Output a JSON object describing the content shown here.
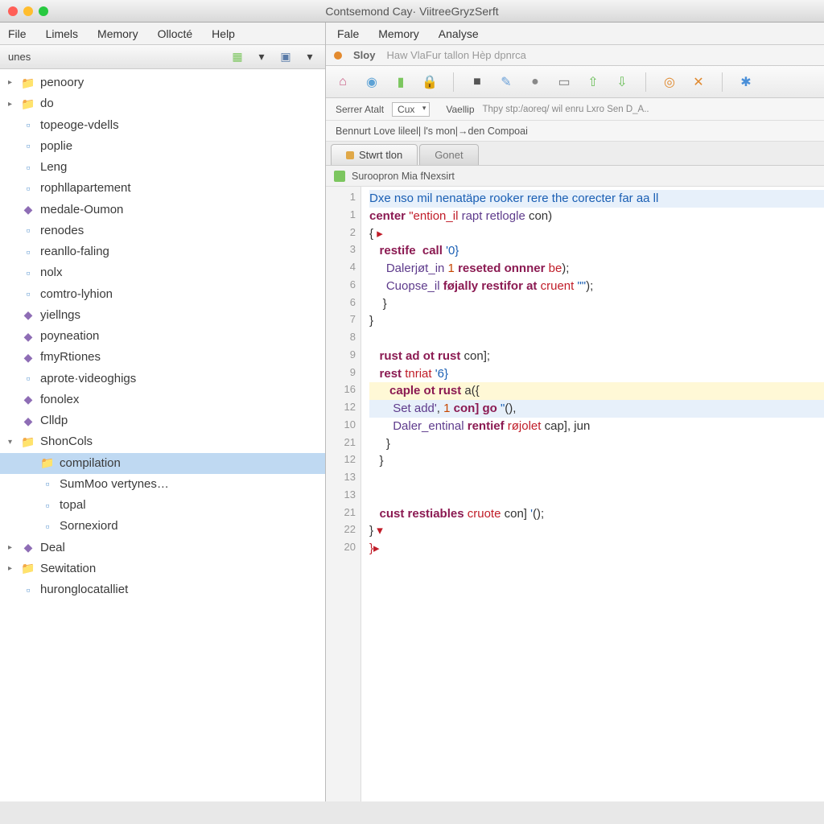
{
  "window_title": "Contsemond Cay· ViitreeGryzSerft",
  "left_menu": [
    "File",
    "Limels",
    "Memory",
    "Ollocté",
    "Help"
  ],
  "right_menu": [
    "Fale",
    "Memory",
    "Analyse"
  ],
  "left_header_title": "unes",
  "tree": [
    {
      "label": "penoory",
      "icon": "folder",
      "tri": "▸"
    },
    {
      "label": "do",
      "icon": "folder",
      "tri": "▸"
    },
    {
      "label": "topeoge-vdells",
      "icon": "file",
      "tri": ""
    },
    {
      "label": "poplie",
      "icon": "file",
      "tri": ""
    },
    {
      "label": "Leng",
      "icon": "file",
      "tri": ""
    },
    {
      "label": "rophllapartement",
      "icon": "file",
      "tri": ""
    },
    {
      "label": "medale-Oumon",
      "icon": "purple",
      "tri": ""
    },
    {
      "label": "renodes",
      "icon": "file",
      "tri": ""
    },
    {
      "label": "reanllo-faling",
      "icon": "file",
      "tri": ""
    },
    {
      "label": "nolx",
      "icon": "file",
      "tri": ""
    },
    {
      "label": "comtro-lyhion",
      "icon": "file",
      "tri": ""
    },
    {
      "label": "yiellngs",
      "icon": "purple",
      "tri": ""
    },
    {
      "label": "poyneation",
      "icon": "purple",
      "tri": ""
    },
    {
      "label": "fmyRtiones",
      "icon": "purple",
      "tri": ""
    },
    {
      "label": "aprote·videoghigs",
      "icon": "file",
      "tri": ""
    },
    {
      "label": "fonolex",
      "icon": "purple",
      "tri": ""
    },
    {
      "label": "Clldp",
      "icon": "purple",
      "tri": ""
    },
    {
      "label": "ShonCols",
      "icon": "folder",
      "tri": "▾"
    },
    {
      "label": "compilation",
      "icon": "folder",
      "tri": "",
      "indent": 1,
      "selected": true
    },
    {
      "label": "SumMoo vertynes…",
      "icon": "file",
      "tri": "",
      "indent": 1
    },
    {
      "label": "topal",
      "icon": "file",
      "tri": "",
      "indent": 1
    },
    {
      "label": "Sornexiord",
      "icon": "file",
      "tri": "",
      "indent": 1
    },
    {
      "label": "Deal",
      "icon": "purple",
      "tri": "▸"
    },
    {
      "label": "Sewitation",
      "icon": "folder",
      "tri": "▸"
    },
    {
      "label": "huronglocatalliet",
      "icon": "file",
      "tri": ""
    }
  ],
  "tab_strip": {
    "main": "Sloy",
    "rest": "Haw  VlaFur  tallon  Hèp  dpnrca"
  },
  "toolbar_icons": [
    "home-icon",
    "globe-icon",
    "book-icon",
    "lock-icon",
    "stop-icon",
    "edit-icon",
    "record-icon",
    "monitor-icon",
    "upload-icon",
    "download-icon",
    "target-icon",
    "close-icon",
    "star-icon"
  ],
  "toolbar_colors": [
    "#c95c84",
    "#5da2d5",
    "#7cc65f",
    "#d9a93a",
    "#555",
    "#6aa0d8",
    "#888",
    "#7a7a7a",
    "#6bbf59",
    "#6bbf59",
    "#e0892e",
    "#e0892e",
    "#4a8fd8"
  ],
  "config": {
    "label1": "Serrer Atalt",
    "select_value": "Cux",
    "label2": "Vaellip",
    "rest": "Thpy stp:/aoreq/ wil enru Lxro Sen D_A.."
  },
  "breadcrumb": "Bennurt Love lileel| l's mon|→den Compoai",
  "file_tabs": [
    {
      "label": "Stwrt tlon",
      "active": true
    },
    {
      "label": "Gonet",
      "active": false
    }
  ],
  "path_bar": "Suroopron Mia fNexsirt",
  "code_lines": [
    {
      "n": "1",
      "hl": "hl",
      "spans": [
        {
          "c": "cm",
          "t": "Dxe nso mil nenatäpe rooker rere the corecter far aa ll"
        }
      ]
    },
    {
      "n": "1",
      "spans": [
        {
          "c": "kw",
          "t": "center "
        },
        {
          "c": "err",
          "t": "\"ention_il "
        },
        {
          "c": "fn",
          "t": "rapt retlogle"
        },
        {
          "c": "",
          "t": " con"
        },
        {
          "c": "paren",
          "t": ")"
        }
      ]
    },
    {
      "n": "2",
      "spans": [
        {
          "c": "paren",
          "t": "{ "
        },
        {
          "c": "err",
          "t": "▸"
        }
      ]
    },
    {
      "n": "3",
      "spans": [
        {
          "c": "",
          "t": "   "
        },
        {
          "c": "kw",
          "t": "restife  call"
        },
        {
          "c": "",
          "t": " "
        },
        {
          "c": "str",
          "t": "'0}"
        }
      ]
    },
    {
      "n": "4",
      "spans": [
        {
          "c": "",
          "t": "     "
        },
        {
          "c": "fn",
          "t": "Dalerjøt_in"
        },
        {
          "c": "",
          "t": " "
        },
        {
          "c": "num",
          "t": "1"
        },
        {
          "c": "",
          "t": " "
        },
        {
          "c": "kw",
          "t": "reseted onnner"
        },
        {
          "c": "",
          "t": " "
        },
        {
          "c": "err",
          "t": "be"
        },
        {
          "c": "paren",
          "t": ");"
        }
      ]
    },
    {
      "n": "6",
      "spans": [
        {
          "c": "",
          "t": "     "
        },
        {
          "c": "fn",
          "t": "Cuopse_il"
        },
        {
          "c": "",
          "t": " "
        },
        {
          "c": "kw",
          "t": "føjally restifor at"
        },
        {
          "c": "",
          "t": " "
        },
        {
          "c": "err",
          "t": "cruent"
        },
        {
          "c": "",
          "t": " "
        },
        {
          "c": "str",
          "t": "\"\""
        },
        {
          "c": "paren",
          "t": ");"
        }
      ]
    },
    {
      "n": "6",
      "spans": [
        {
          "c": "",
          "t": "    "
        },
        {
          "c": "paren",
          "t": "}"
        }
      ]
    },
    {
      "n": "7",
      "spans": [
        {
          "c": "paren",
          "t": "}"
        }
      ]
    },
    {
      "n": "8",
      "spans": [
        {
          "c": "",
          "t": ""
        }
      ]
    },
    {
      "n": "9",
      "spans": [
        {
          "c": "",
          "t": "   "
        },
        {
          "c": "kw",
          "t": "rust ad ot rust"
        },
        {
          "c": "",
          "t": " con];"
        }
      ]
    },
    {
      "n": "9",
      "spans": [
        {
          "c": "",
          "t": "   "
        },
        {
          "c": "kw",
          "t": "rest"
        },
        {
          "c": "",
          "t": " "
        },
        {
          "c": "err",
          "t": "tnriat"
        },
        {
          "c": "",
          "t": " "
        },
        {
          "c": "str",
          "t": "'6}"
        }
      ]
    },
    {
      "n": "16",
      "hl": "hl2",
      "spans": [
        {
          "c": "",
          "t": "      "
        },
        {
          "c": "kw",
          "t": "caple ot rust"
        },
        {
          "c": "",
          "t": " a"
        },
        {
          "c": "paren",
          "t": "({"
        }
      ]
    },
    {
      "n": "12",
      "hl": "hl",
      "spans": [
        {
          "c": "",
          "t": "       "
        },
        {
          "c": "fn",
          "t": "Set add'"
        },
        {
          "c": "",
          "t": ", "
        },
        {
          "c": "num",
          "t": "1"
        },
        {
          "c": "",
          "t": " "
        },
        {
          "c": "kw",
          "t": "con] go"
        },
        {
          "c": "",
          "t": " "
        },
        {
          "c": "str",
          "t": "\""
        },
        {
          "c": "paren",
          "t": "(),"
        }
      ]
    },
    {
      "n": "10",
      "spans": [
        {
          "c": "",
          "t": "       "
        },
        {
          "c": "fn",
          "t": "Daler_entinal"
        },
        {
          "c": "",
          "t": " "
        },
        {
          "c": "kw",
          "t": "rentief"
        },
        {
          "c": "",
          "t": " "
        },
        {
          "c": "err",
          "t": "røjolet"
        },
        {
          "c": "",
          "t": " cap], jun"
        }
      ]
    },
    {
      "n": "21",
      "spans": [
        {
          "c": "",
          "t": "     "
        },
        {
          "c": "paren",
          "t": "}"
        }
      ]
    },
    {
      "n": "12",
      "spans": [
        {
          "c": "",
          "t": "   "
        },
        {
          "c": "paren",
          "t": "}"
        }
      ]
    },
    {
      "n": "13",
      "spans": [
        {
          "c": "",
          "t": ""
        }
      ]
    },
    {
      "n": "13",
      "spans": [
        {
          "c": "",
          "t": ""
        }
      ]
    },
    {
      "n": "21",
      "spans": [
        {
          "c": "",
          "t": "   "
        },
        {
          "c": "kw",
          "t": "cust restiables"
        },
        {
          "c": "",
          "t": " "
        },
        {
          "c": "err",
          "t": "cruote"
        },
        {
          "c": "",
          "t": " con] "
        },
        {
          "c": "str",
          "t": "'"
        },
        {
          "c": "paren",
          "t": "();"
        }
      ]
    },
    {
      "n": "22",
      "spans": [
        {
          "c": "paren",
          "t": "}"
        },
        {
          "c": "",
          "t": " "
        },
        {
          "c": "err",
          "t": "▾"
        }
      ]
    },
    {
      "n": "20",
      "spans": [
        {
          "c": "err",
          "t": "}▸"
        }
      ]
    }
  ]
}
